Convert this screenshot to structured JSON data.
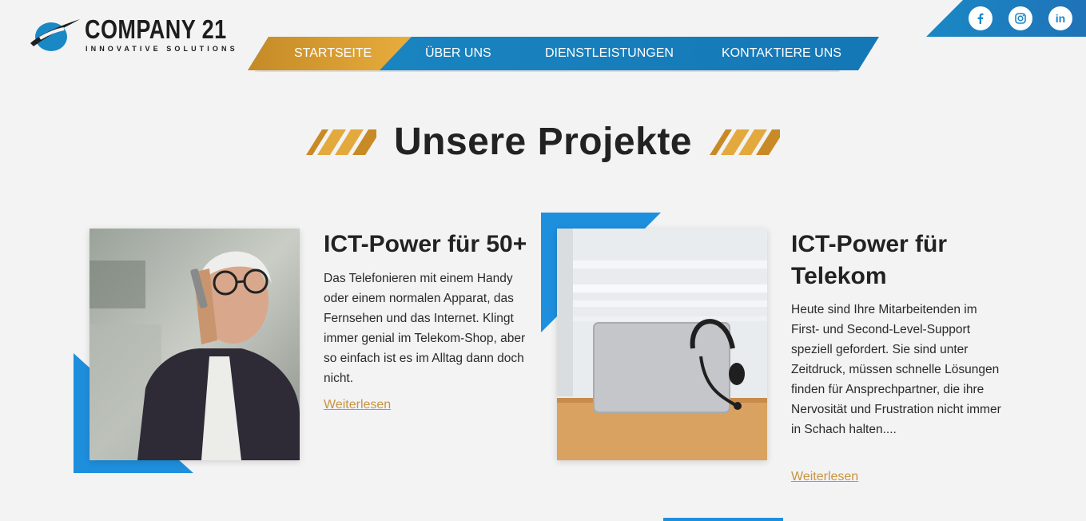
{
  "brand": {
    "name": "COMPANY 21",
    "tagline": "INNOVATIVE SOLUTIONS",
    "colors": {
      "blue": "#1a88c4",
      "gold": "#e8ad3c",
      "text": "#222222"
    }
  },
  "nav": {
    "items": [
      {
        "label": "STARTSEITE",
        "active": true
      },
      {
        "label": "ÜBER UNS",
        "active": false
      },
      {
        "label": "DIENSTLEISTUNGEN",
        "active": false
      },
      {
        "label": "KONTAKTIERE UNS",
        "active": false
      }
    ]
  },
  "social": {
    "icons": [
      "facebook-icon",
      "instagram-icon",
      "linkedin-icon"
    ]
  },
  "section": {
    "title": "Unsere Projekte"
  },
  "projects": [
    {
      "title": "ICT-Power für 50+",
      "text": "Das Telefonieren mit einem Handy oder einem normalen Apparat, das Fernsehen und das Internet. Klingt immer genial im Telekom-Shop, aber so einfach ist es im Alltag dann doch nicht.",
      "link": "Weiterlesen",
      "image_alt": "Älterer Mann telefoniert mit Handy"
    },
    {
      "title_line1": "ICT-Power für",
      "title_line2": "Telekom",
      "text": "Heute sind Ihre Mitarbeitenden im First- und Second-Level-Support speziell gefordert. Sie sind unter Zeitdruck, müssen schnelle Lösungen finden für Ansprechpartner, die ihre Nervosität und Frustration nicht immer in Schach halten....",
      "link": "Weiterlesen",
      "image_alt": "Laptop mit Headset auf Holztisch"
    }
  ]
}
